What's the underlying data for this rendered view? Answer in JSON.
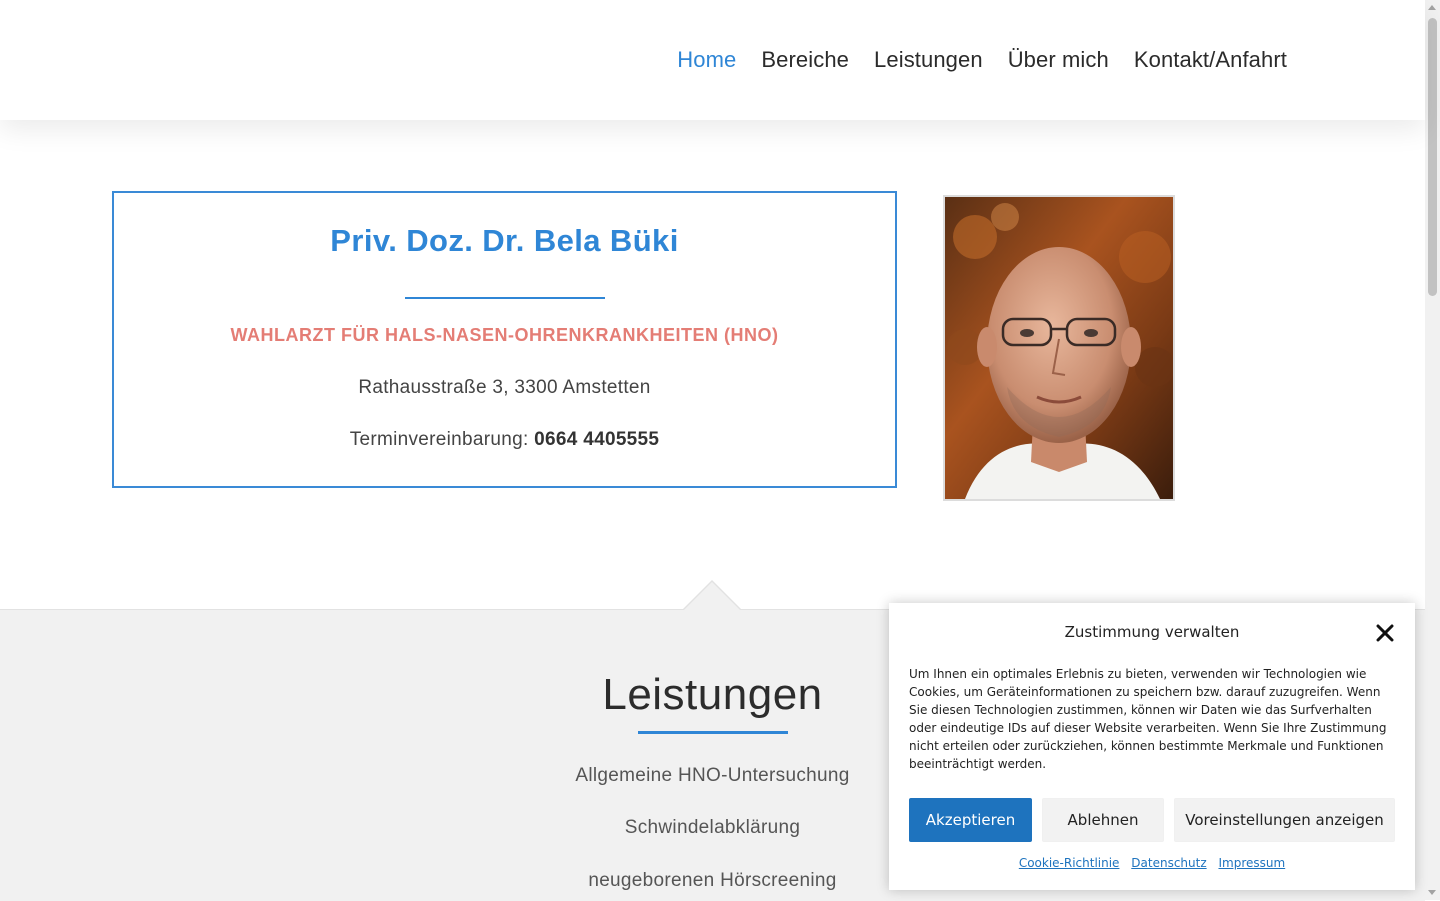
{
  "nav": {
    "items": [
      {
        "label": "Home",
        "active": true
      },
      {
        "label": "Bereiche",
        "active": false
      },
      {
        "label": "Leistungen",
        "active": false
      },
      {
        "label": "Über mich",
        "active": false
      },
      {
        "label": "Kontakt/Anfahrt",
        "active": false
      }
    ]
  },
  "hero": {
    "title": "Priv. Doz. Dr. Bela Büki",
    "subtitle": "WAHLARZT FÜR HALS-NASEN-OHRENKRANKHEITEN (HNO)",
    "address": "Rathausstraße 3, 3300 Amstetten",
    "appointment_label": "Terminvereinbarung: ",
    "phone": "0664 4405555"
  },
  "services": {
    "title": "Leistungen",
    "items": [
      "Allgemeine HNO-Untersuchung",
      "Schwindelabklärung",
      "neugeborenen Hörscreening"
    ]
  },
  "cookie": {
    "title": "Zustimmung verwalten",
    "text": "Um Ihnen ein optimales Erlebnis zu bieten, verwenden wir Technologien wie Cookies, um Geräteinformationen zu speichern bzw. darauf zuzugreifen. Wenn Sie diesen Technologien zustimmen, können wir Daten wie das Surfverhalten oder eindeutige IDs auf dieser Website verarbeiten. Wenn Sie Ihre Zustimmung nicht erteilen oder zurückziehen, können bestimmte Merkmale und Funktionen beeinträchtigt werden.",
    "accept": "Akzeptieren",
    "deny": "Ablehnen",
    "preferences": "Voreinstellungen anzeigen",
    "links": [
      "Cookie-Richtlinie",
      "Datenschutz",
      "Impressum"
    ]
  },
  "colors": {
    "accent": "#2f86d6",
    "subtitle": "#e47d75",
    "button": "#1e73be"
  },
  "icons": {
    "close": "close-icon"
  }
}
